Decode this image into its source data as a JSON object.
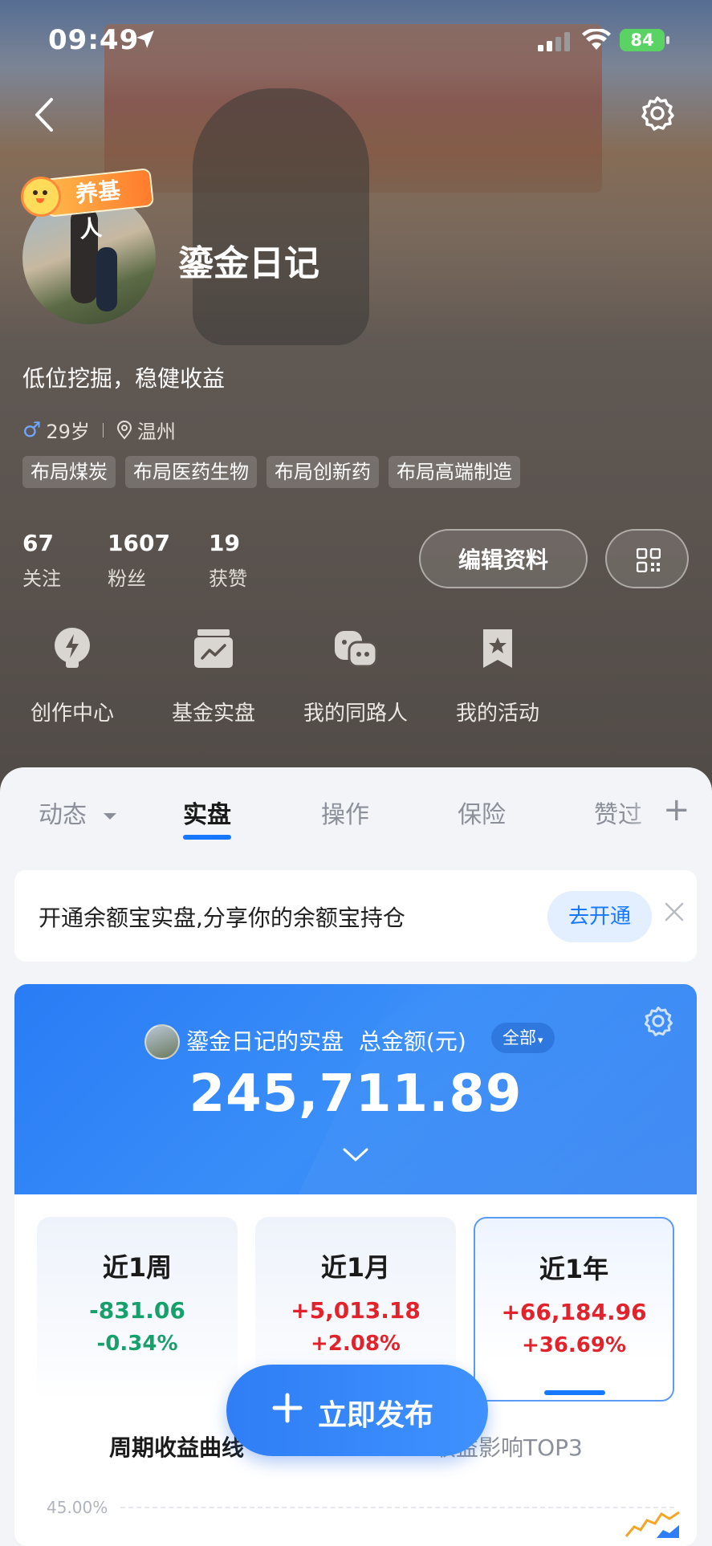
{
  "status_bar": {
    "time": "09:49",
    "battery": "84"
  },
  "profile": {
    "badge": "养基人",
    "name": "鎏金日记",
    "bio": "低位挖掘，稳健收益",
    "age": "29岁",
    "city": "温州",
    "tags": [
      "布局煤炭",
      "布局医药生物",
      "布局创新药",
      "布局高端制造"
    ],
    "stats": [
      {
        "value": "67",
        "label": "关注"
      },
      {
        "value": "1607",
        "label": "粉丝"
      },
      {
        "value": "19",
        "label": "获赞"
      }
    ],
    "edit_button": "编辑资料"
  },
  "entries": [
    {
      "label": "创作中心",
      "icon": "lightning-bulb-icon"
    },
    {
      "label": "基金实盘",
      "icon": "chart-box-icon"
    },
    {
      "label": "我的同路人",
      "icon": "chat-people-icon"
    },
    {
      "label": "我的活动",
      "icon": "bookmark-star-icon"
    }
  ],
  "tabs": {
    "items": [
      "动态",
      "实盘",
      "操作",
      "保险",
      "赞过"
    ],
    "active": "实盘"
  },
  "banner": {
    "text": "开通余额宝实盘,分享你的余额宝持仓",
    "button": "去开通"
  },
  "portfolio": {
    "title": "鎏金日记的实盘",
    "total_label": "总金额(元)",
    "filter": "全部",
    "amount": "245,711.89",
    "periods": [
      {
        "label": "近1周",
        "value": "-831.06",
        "pct": "-0.34%",
        "trend": "down"
      },
      {
        "label": "近1月",
        "value": "+5,013.18",
        "pct": "+2.08%",
        "trend": "up"
      },
      {
        "label": "近1年",
        "value": "+66,184.96",
        "pct": "+36.69%",
        "trend": "up",
        "selected": true
      }
    ],
    "section_left": "周期收益曲线",
    "section_right": "收益影响TOP3",
    "y_tick": "45.00%"
  },
  "fab": {
    "label": "立即发布"
  },
  "colors": {
    "accent": "#1677ff",
    "positive": "#e2232b",
    "negative": "#16a06b"
  }
}
